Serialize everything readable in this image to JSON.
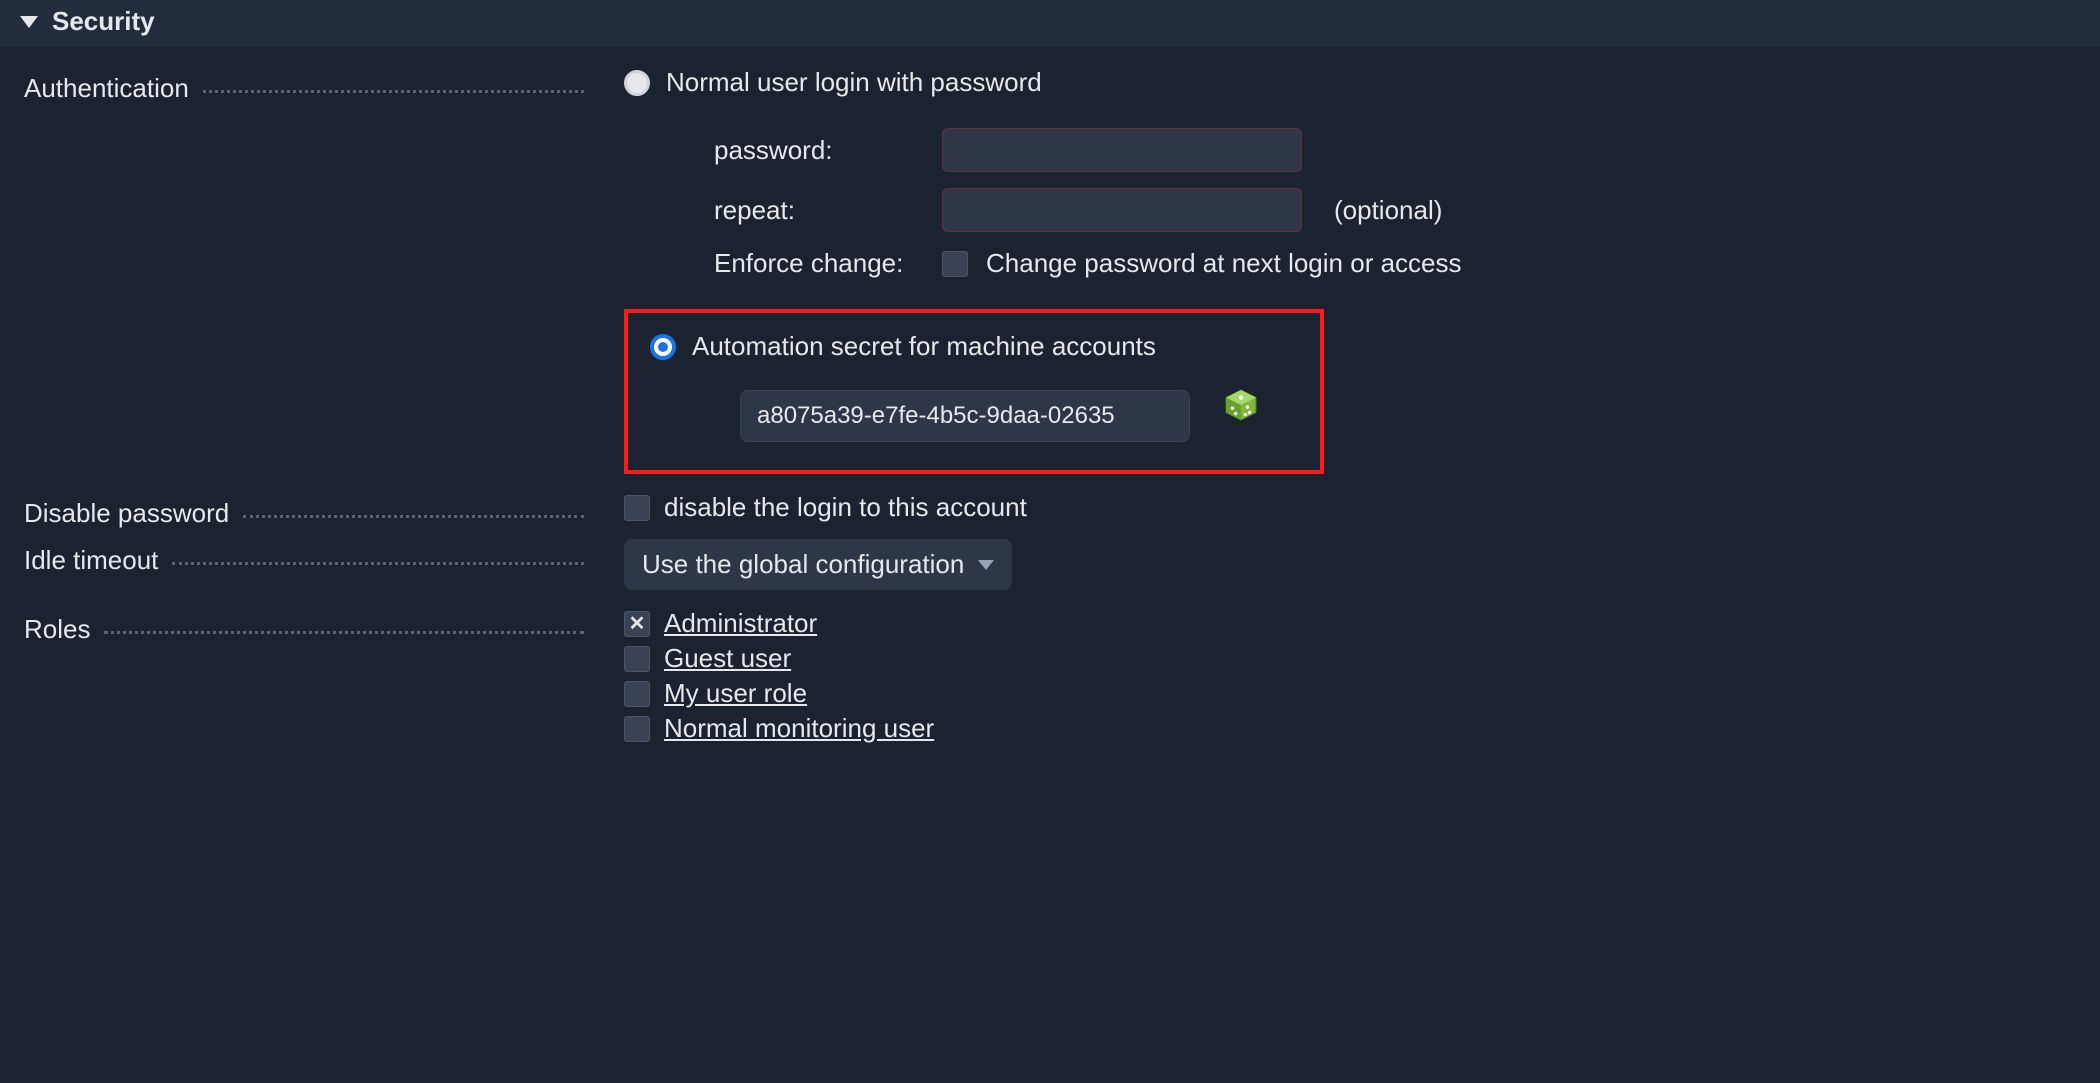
{
  "section": {
    "title": "Security"
  },
  "auth": {
    "label": "Authentication",
    "normal_login_label": "Normal user login with password",
    "password_label": "password:",
    "repeat_label": "repeat:",
    "optional_label": "(optional)",
    "enforce_label": "Enforce change:",
    "enforce_checkbox_label": "Change password at next login or access",
    "automation_label": "Automation secret for machine accounts",
    "secret_value": "a8075a39-e7fe-4b5c-9daa-02635",
    "selected": "automation"
  },
  "disable_pw": {
    "label": "Disable password",
    "checkbox_label": "disable the login to this account"
  },
  "idle": {
    "label": "Idle timeout",
    "selected": "Use the global configuration"
  },
  "roles": {
    "label": "Roles",
    "items": [
      {
        "label": "Administrator",
        "checked": true
      },
      {
        "label": "Guest user",
        "checked": false
      },
      {
        "label": "My user role",
        "checked": false
      },
      {
        "label": "Normal monitoring user",
        "checked": false
      }
    ]
  }
}
